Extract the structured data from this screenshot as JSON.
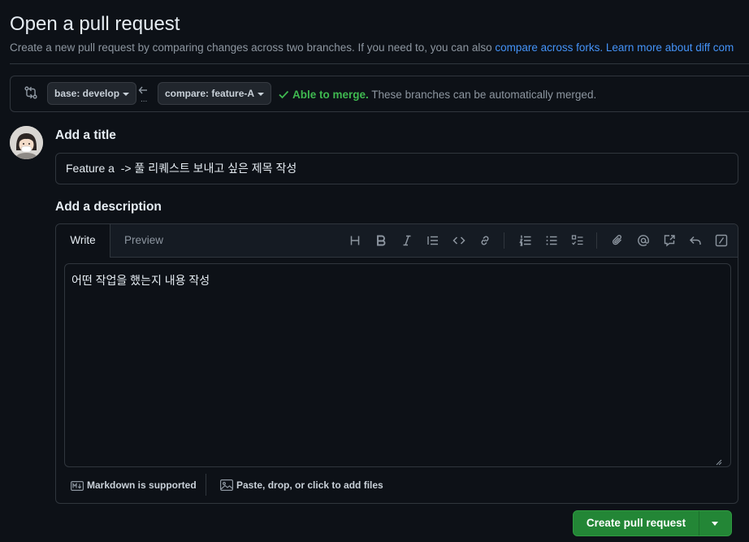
{
  "header": {
    "title": "Open a pull request",
    "subtitle_text": "Create a new pull request by comparing changes across two branches. If you need to, you can also ",
    "compare_forks_link": "compare across forks.",
    "learn_more_link": "Learn more about diff com"
  },
  "range": {
    "base_label": "base: develop",
    "compare_label": "compare: feature-A",
    "dots": "...",
    "merge_ok": "Able to merge.",
    "merge_text": "These branches can be automatically merged."
  },
  "form": {
    "title_label": "Add a title",
    "title_value": "Feature a  -> 풀 리퀘스트 보내고 싶은 제목 작성",
    "description_label": "Add a description",
    "tabs": {
      "write": "Write",
      "preview": "Preview"
    },
    "description_value": "어떤 작업을 했는지 내용 작성",
    "markdown_note": "Markdown is supported",
    "attach_note": "Paste, drop, or click to add files"
  },
  "toolbar_icons": [
    "heading-icon",
    "bold-icon",
    "italic-icon",
    "quote-icon",
    "code-icon",
    "link-icon",
    "ordered-list-icon",
    "unordered-list-icon",
    "task-list-icon",
    "attach-icon",
    "mention-icon",
    "cross-reference-icon",
    "reply-icon",
    "slash-commands-icon"
  ],
  "actions": {
    "create_label": "Create pull request"
  },
  "colors": {
    "accent_link": "#4493f8",
    "success": "#3fb950",
    "primary_button": "#238636",
    "background": "#0d1117"
  }
}
